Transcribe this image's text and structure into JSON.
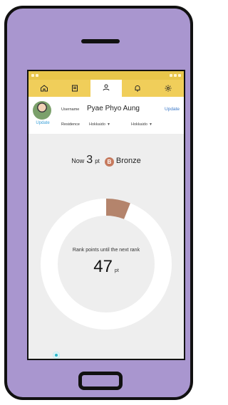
{
  "tabs": [
    {
      "icon": "home-icon"
    },
    {
      "icon": "news-icon"
    },
    {
      "icon": "profile-icon"
    },
    {
      "icon": "bell-icon"
    },
    {
      "icon": "settings-icon"
    }
  ],
  "profile": {
    "avatar_update": "Update",
    "username_label": "Username",
    "username": "Pyae Phyo Aung",
    "username_update": "Update",
    "residence_label": "Residence",
    "residence_1": "Hokkaido",
    "residence_2": "Hokkaido"
  },
  "rank": {
    "now_label": "Now",
    "points": "3",
    "points_unit": "pt",
    "badge": "B",
    "name": "Bronze",
    "next_label": "Rank points until the next rank",
    "remaining": "47",
    "remaining_unit": "pt",
    "progress_fraction": 0.06
  },
  "colors": {
    "phone": "#a996cf",
    "tabbar": "#f0ce5a",
    "statusbar": "#e8c64a",
    "bronze": "#c67a5e",
    "progress": "#b4846c"
  }
}
